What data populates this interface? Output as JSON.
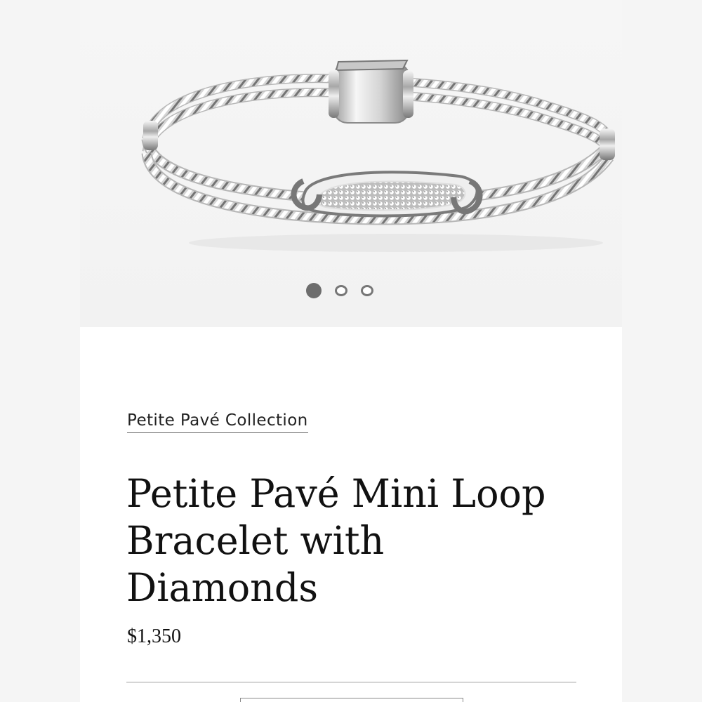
{
  "gallery": {
    "image_alt": "Petite Pavé Mini Loop Bracelet with Diamonds",
    "dots": [
      {
        "active": true
      },
      {
        "active": false
      },
      {
        "active": false
      }
    ]
  },
  "product": {
    "collection_link": "Petite Pavé Collection",
    "title_lines": [
      "Petite Pavé Mini Loop",
      "Bracelet with",
      "Diamonds"
    ],
    "price": "$1,350"
  },
  "colors": {
    "background": "#f3f3f3",
    "panel": "#ffffff",
    "text": "#111111",
    "dot_active": "#6d6d6d"
  }
}
